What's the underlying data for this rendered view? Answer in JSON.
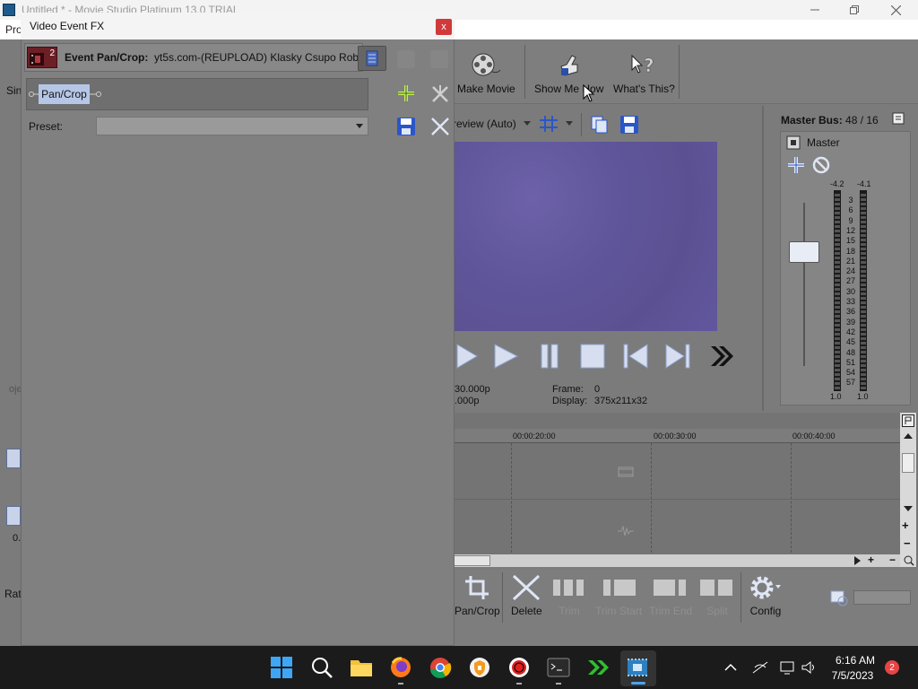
{
  "app": {
    "title": "Untitled * - Movie Studio Platinum 13.0 TRIAL",
    "menu_partial": "Pro",
    "left_labels": {
      "sim": "Sin",
      "rat": "Rat",
      "zero": "0.",
      "obj": "oje"
    }
  },
  "toolbar": {
    "make_movie": "Make Movie",
    "show_me_how": "Show Me How",
    "whats_this": "What's This?"
  },
  "preview": {
    "quality": "review (Auto)",
    "frame_label": "Frame:",
    "frame_value": "0",
    "display_label": "Display:",
    "display_value": "375x211x32",
    "project_info": "30.000p",
    "preview_info": ".000p"
  },
  "master_bus": {
    "title": "Master Bus:",
    "count": "48 / 16",
    "master_label": "Master",
    "peak_left": "-4.2",
    "peak_right": "-4.1",
    "scale": [
      "3",
      "6",
      "9",
      "12",
      "15",
      "18",
      "21",
      "24",
      "27",
      "30",
      "33",
      "36",
      "39",
      "42",
      "45",
      "48",
      "51",
      "54",
      "57"
    ],
    "bottom_left": "1.0",
    "bottom_right": "1.0"
  },
  "timeline": {
    "ruler": [
      "00:00:20:00",
      "00:00:30:00",
      "00:00:40:00"
    ]
  },
  "bottom_toolbar": {
    "pan_crop": "Pan/Crop",
    "delete": "Delete",
    "trim": "Trim",
    "trim_start": "Trim Start",
    "trim_end": "Trim End",
    "split": "Split",
    "config": "Config"
  },
  "fx_dialog": {
    "title": "Video Event FX",
    "close": "x",
    "event_number": "2",
    "event_label": "Event Pan/Crop:",
    "event_name": "yt5s.com-(REUPLOAD) Klasky Csupo Robot",
    "chain_item": "Pan/Crop",
    "preset_label": "Preset:",
    "preset_value": ""
  },
  "taskbar": {
    "time": "6:16 AM",
    "date": "7/5/2023",
    "notifications": "2"
  },
  "colors": {
    "preview_purple": "#5f559a",
    "chip_blue": "#b6c6e6",
    "close_red": "#d03a3a",
    "record_red": "#e02020"
  }
}
